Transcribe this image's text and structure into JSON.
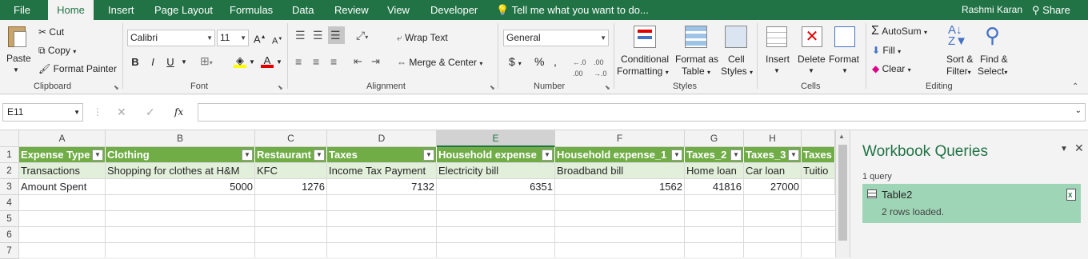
{
  "menu": {
    "tabs": [
      "File",
      "Home",
      "Insert",
      "Page Layout",
      "Formulas",
      "Data",
      "Review",
      "View",
      "Developer"
    ],
    "tell_me": "Tell me what you want to do...",
    "user": "Rashmi Karan",
    "share": "Share"
  },
  "ribbon": {
    "clipboard": {
      "paste": "Paste",
      "cut": "Cut",
      "copy": "Copy",
      "format_painter": "Format Painter",
      "label": "Clipboard"
    },
    "font": {
      "name": "Calibri",
      "size": "11",
      "bold": "B",
      "italic": "I",
      "underline": "U",
      "label": "Font"
    },
    "alignment": {
      "wrap_text": "Wrap Text",
      "merge_center": "Merge & Center",
      "label": "Alignment"
    },
    "number": {
      "format": "General",
      "currency": "$",
      "percent": "%",
      "comma": ",",
      "label": "Number"
    },
    "styles": {
      "cond_fmt_1": "Conditional",
      "cond_fmt_2": "Formatting",
      "fmt_table_1": "Format as",
      "fmt_table_2": "Table",
      "cell_styles_1": "Cell",
      "cell_styles_2": "Styles",
      "label": "Styles"
    },
    "cells": {
      "insert": "Insert",
      "delete": "Delete",
      "format": "Format",
      "label": "Cells"
    },
    "editing": {
      "autosum": "AutoSum",
      "fill": "Fill",
      "clear": "Clear",
      "sort_1": "Sort &",
      "sort_2": "Filter",
      "find_1": "Find &",
      "find_2": "Select",
      "label": "Editing"
    }
  },
  "formula_bar": {
    "name_box": "E11",
    "fx": "fx",
    "value": ""
  },
  "sheet": {
    "columns": [
      "A",
      "B",
      "C",
      "D",
      "E",
      "F",
      "G",
      "H"
    ],
    "rows": [
      "1",
      "2",
      "3",
      "4",
      "5",
      "6",
      "7"
    ],
    "header_row": [
      "Expense Type",
      "Clothing",
      "Restaurant",
      "Taxes",
      "Household expense",
      "Household expense_1",
      "Taxes_2",
      "Taxes_3",
      "Taxes"
    ],
    "row2": [
      "Transactions",
      "Shopping for clothes at H&M",
      "KFC",
      "Income Tax Payment",
      "Electricity bill",
      "Broadband bill",
      "Home loan",
      "Car loan",
      "Tuitio"
    ],
    "row3": [
      "Amount Spent",
      "5000",
      "1276",
      "7132",
      "6351",
      "1562",
      "41816",
      "27000",
      ""
    ]
  },
  "queries_pane": {
    "title": "Workbook Queries",
    "count": "1 query",
    "query_name": "Table2",
    "query_status": "2 rows loaded."
  }
}
